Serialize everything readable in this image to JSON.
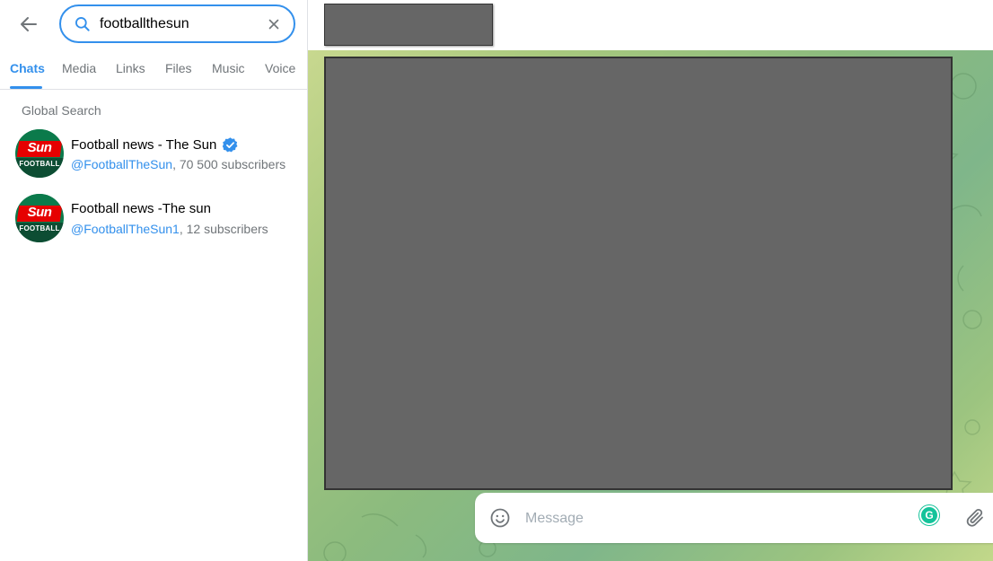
{
  "search": {
    "query": "footballthesun",
    "back_icon": "arrow-left-icon",
    "search_icon": "search-icon",
    "clear_icon": "close-icon"
  },
  "tabs": [
    {
      "label": "Chats",
      "active": true
    },
    {
      "label": "Media",
      "active": false
    },
    {
      "label": "Links",
      "active": false
    },
    {
      "label": "Files",
      "active": false
    },
    {
      "label": "Music",
      "active": false
    },
    {
      "label": "Voice",
      "active": false
    }
  ],
  "global_search": {
    "title": "Global Search",
    "results": [
      {
        "name": "Football news - The Sun",
        "verified": true,
        "handle": "@FootballTheSun",
        "subscribers": ", 70 500 subscribers",
        "avatar_text_top": "Sun",
        "avatar_text_bottom": "FOOTBALL"
      },
      {
        "name": "Football news -The sun",
        "verified": false,
        "handle": "@FootballTheSun1",
        "subscribers": ", 12 subscribers",
        "avatar_text_top": "Sun",
        "avatar_text_bottom": "FOOTBALL"
      }
    ]
  },
  "composer": {
    "placeholder": "Message",
    "emoji_icon": "smile-icon",
    "attach_icon": "paperclip-icon",
    "grammarly_label": "G"
  },
  "colors": {
    "accent": "#3390ec",
    "muted_text": "#707579",
    "redaction": "#666666"
  }
}
